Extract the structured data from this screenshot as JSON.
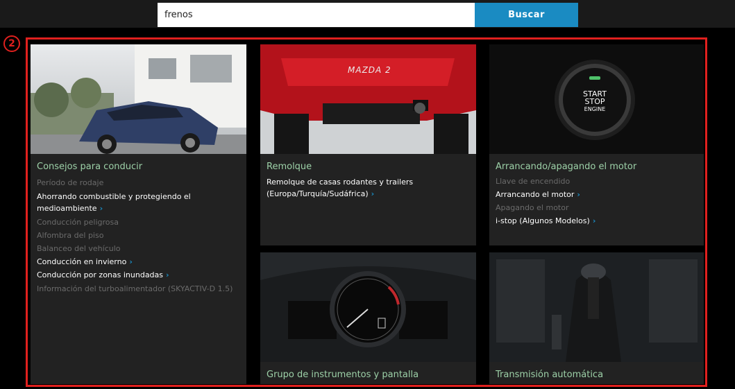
{
  "search": {
    "value": "frenos",
    "button_label": "Buscar"
  },
  "annotation": {
    "number": "2"
  },
  "cards": {
    "driving": {
      "title": "Consejos para conducir",
      "items": [
        {
          "label": "Período de rodaje",
          "link": false
        },
        {
          "label": "Ahorrando combustible y protegiendo el medioambiente",
          "link": true
        },
        {
          "label": "Conducción peligrosa",
          "link": false
        },
        {
          "label": "Alfombra del piso",
          "link": false
        },
        {
          "label": "Balanceo del vehículo",
          "link": false
        },
        {
          "label": "Conducción en invierno",
          "link": true
        },
        {
          "label": "Conducción por zonas inundadas",
          "link": true
        },
        {
          "label": "Información del turboalimentador (SKYACTIV-D 1.5)",
          "link": false
        }
      ]
    },
    "towing": {
      "title": "Remolque",
      "items": [
        {
          "label": "Remolque de casas rodantes y trailers (Europa/Turquía/Sudáfrica)",
          "link": true
        }
      ],
      "car_badge": "MAZDA 2"
    },
    "engine": {
      "title": "Arrancando/apagando el motor",
      "items": [
        {
          "label": "Llave de encendido",
          "link": false
        },
        {
          "label": "Arrancando el motor",
          "link": true
        },
        {
          "label": "Apagando el motor",
          "link": false
        },
        {
          "label": "i-stop (Algunos Modelos)",
          "link": true
        }
      ],
      "button_text": {
        "line1": "START",
        "line2": "STOP",
        "line3": "ENGINE"
      }
    },
    "instruments": {
      "title": "Grupo de instrumentos y pantalla"
    },
    "transmission": {
      "title": "Transmisión automática"
    }
  },
  "colors": {
    "accent": "#1a8bc2",
    "title_green": "#9dd1a8",
    "annotation_red": "#e0201e",
    "card_bg": "#222222"
  }
}
